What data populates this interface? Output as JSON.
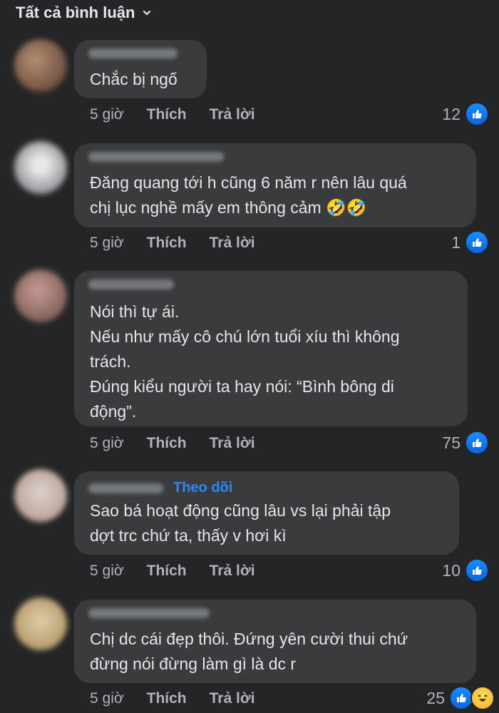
{
  "header": {
    "title": "Tất cả bình luận"
  },
  "comments": [
    {
      "text": "Chắc bị ngố",
      "time": "5 giờ",
      "like": "Thích",
      "reply": "Trả lời",
      "reactions": "12",
      "avatar_color": "#7a5d4a"
    },
    {
      "text": "Đăng quang tới h cũng 6 năm r nên lâu quá\nchị lục nghề mấy em thông cảm 🤣🤣",
      "time": "5 giờ",
      "like": "Thích",
      "reply": "Trả lời",
      "reactions": "1",
      "avatar_color": "#c9cbcf"
    },
    {
      "text": "Nói thì tự ái.\nNếu như mấy cô chú lớn tuổi xíu thì không\ntrách.\nĐúng kiểu người ta hay nói: “Bình bông di\nđộng”.",
      "time": "5 giờ",
      "like": "Thích",
      "reply": "Trả lời",
      "reactions": "75",
      "avatar_color": "#8c6f66"
    },
    {
      "follow": "Theo dõi",
      "text": "Sao bá hoạt động cũng lâu vs lại phải tập\ndợt trc chứ ta, thấy v hơi kì",
      "time": "5 giờ",
      "like": "Thích",
      "reply": "Trả lời",
      "reactions": "10",
      "avatar_color": "#d8c4bb"
    },
    {
      "text": "Chị dc cái đẹp thôi. Đứng yên cười thui chứ\nđừng nói đừng làm gì là dc r",
      "time": "5 giờ",
      "like": "Thích",
      "reply": "Trả lời",
      "reactions": "25",
      "avatar_color": "#d9b98c"
    }
  ],
  "colors": {
    "background": "#242526",
    "bubble": "#3a3b3c",
    "accent": "#2d88ff",
    "secondary_text": "#b0b3b8"
  },
  "icons": {
    "like": "like-icon",
    "haha": "haha-icon",
    "dropdown": "chevron-down-icon"
  }
}
